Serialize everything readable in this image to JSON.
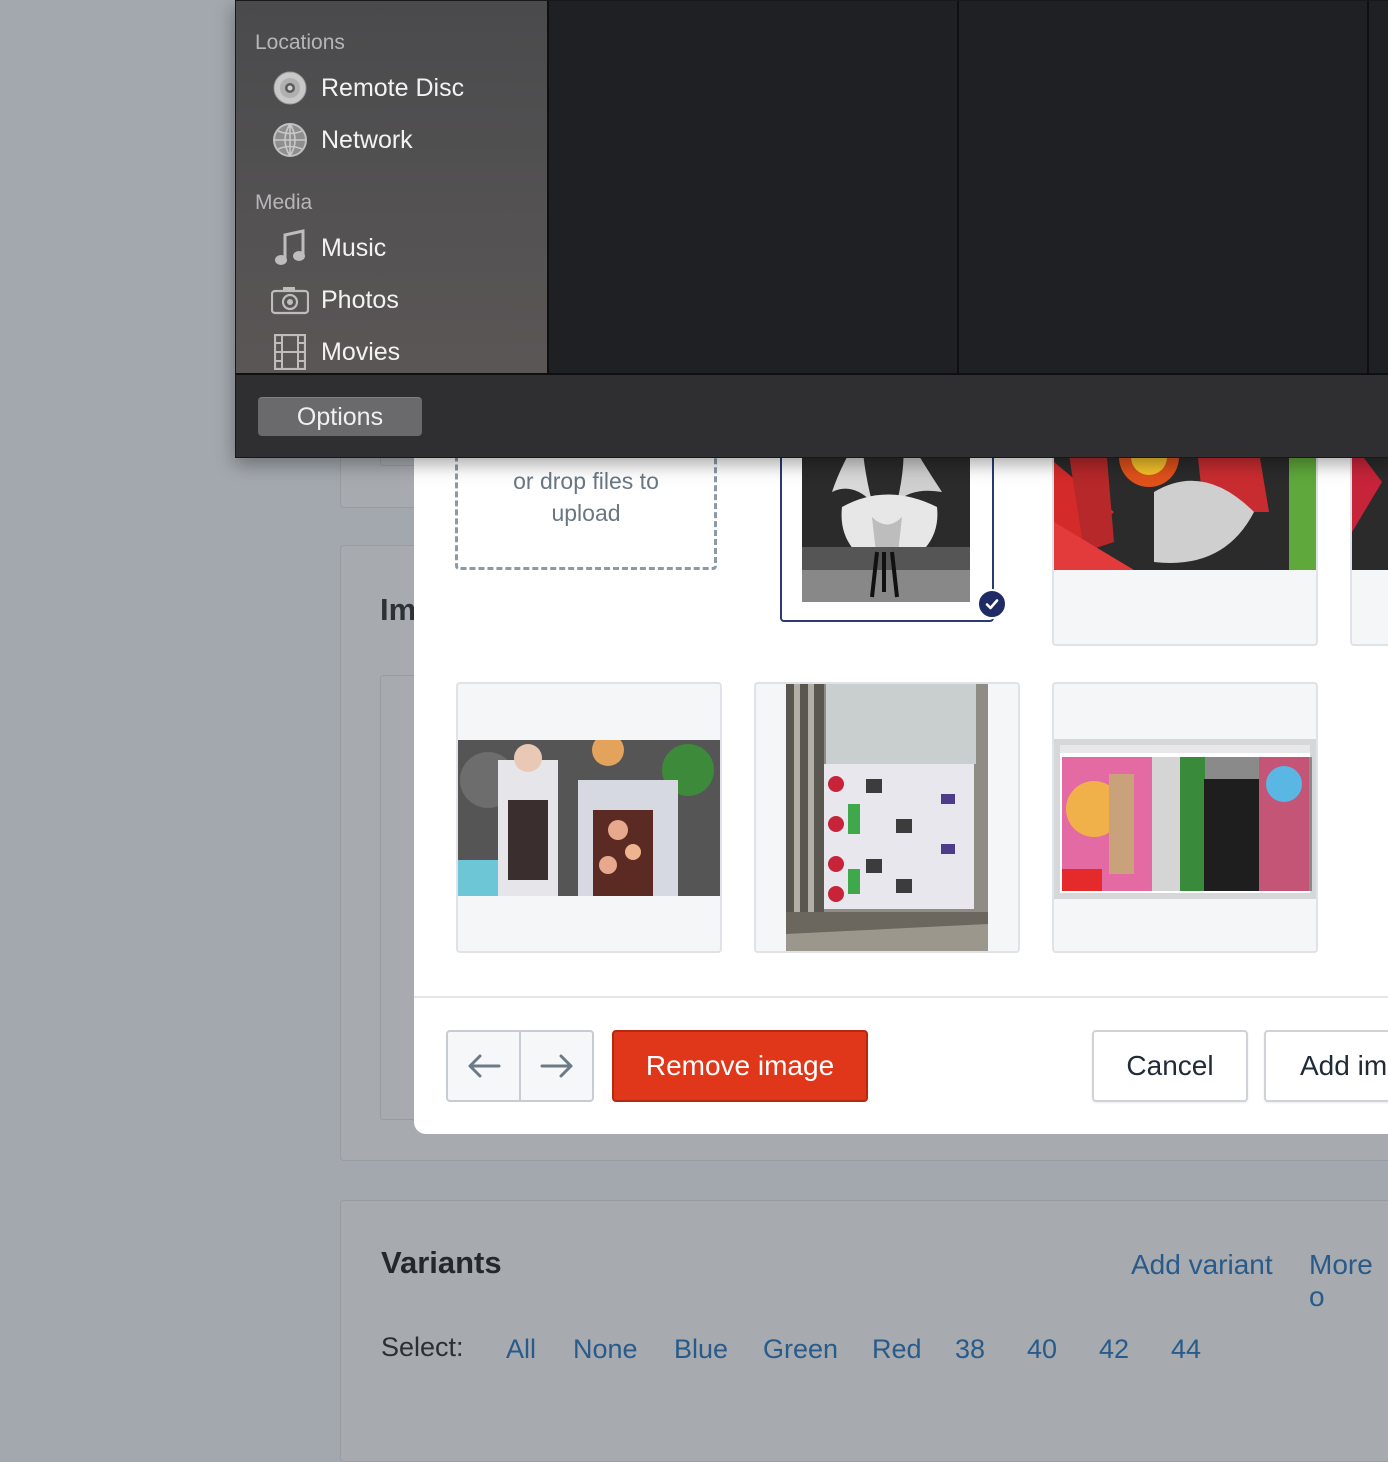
{
  "background_page": {
    "images_heading_partial": "Im",
    "variants": {
      "title": "Variants",
      "add_variant": "Add variant",
      "more_options": "More o",
      "select_label": "Select:",
      "select_options": [
        "All",
        "None",
        "Blue",
        "Green",
        "Red",
        "38",
        "40",
        "42",
        "44"
      ]
    }
  },
  "modal": {
    "dropzone_text": "or drop files to upload",
    "selected_image_index": 0,
    "remove_button": "Remove image",
    "cancel_button": "Cancel",
    "add_button": "Add im",
    "prev_icon": "arrow-left-icon",
    "next_icon": "arrow-right-icon",
    "checkmark_icon": "checkmark-icon",
    "colors": {
      "remove": "#e0361a",
      "selected": "#2c3a72"
    }
  },
  "file_dialog": {
    "sidebar": {
      "sections": [
        {
          "title": "Locations",
          "items": [
            {
              "label": "Remote Disc",
              "icon": "disc-icon"
            },
            {
              "label": "Network",
              "icon": "globe-icon"
            }
          ]
        },
        {
          "title": "Media",
          "items": [
            {
              "label": "Music",
              "icon": "music-note-icon"
            },
            {
              "label": "Photos",
              "icon": "camera-icon"
            },
            {
              "label": "Movies",
              "icon": "film-icon"
            }
          ]
        }
      ]
    },
    "options_button": "Options"
  }
}
